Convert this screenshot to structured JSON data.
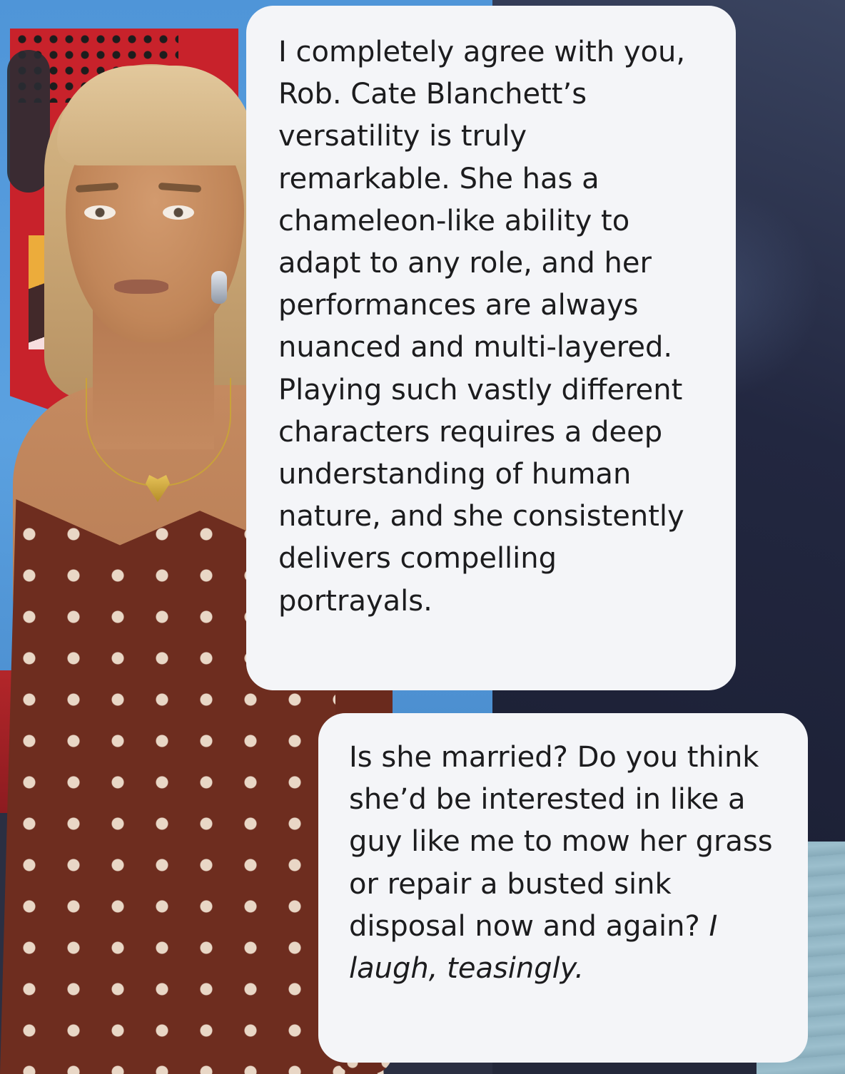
{
  "conversation": {
    "ai_message": {
      "text": "I completely agree with you, Rob. Cate Blanchett’s versatility is truly remarkable. She has a chameleon-like ability to adapt to any role, and her performances are always nuanced and multi-layered. Playing such vastly different characters requires a deep understanding of human nature, and she consistently delivers compelling portrayals."
    },
    "user_message": {
      "text": "Is she married? Do you think she’d be interested in like a guy like me to mow her grass or repair a busted sink disposal now and again?",
      "action": "I laugh, teasingly."
    }
  },
  "colors": {
    "bubble_background": "#f4f5f8",
    "text": "#1c1c1e",
    "dress": "#6e2d1f",
    "sky": "#5ba1e0"
  }
}
